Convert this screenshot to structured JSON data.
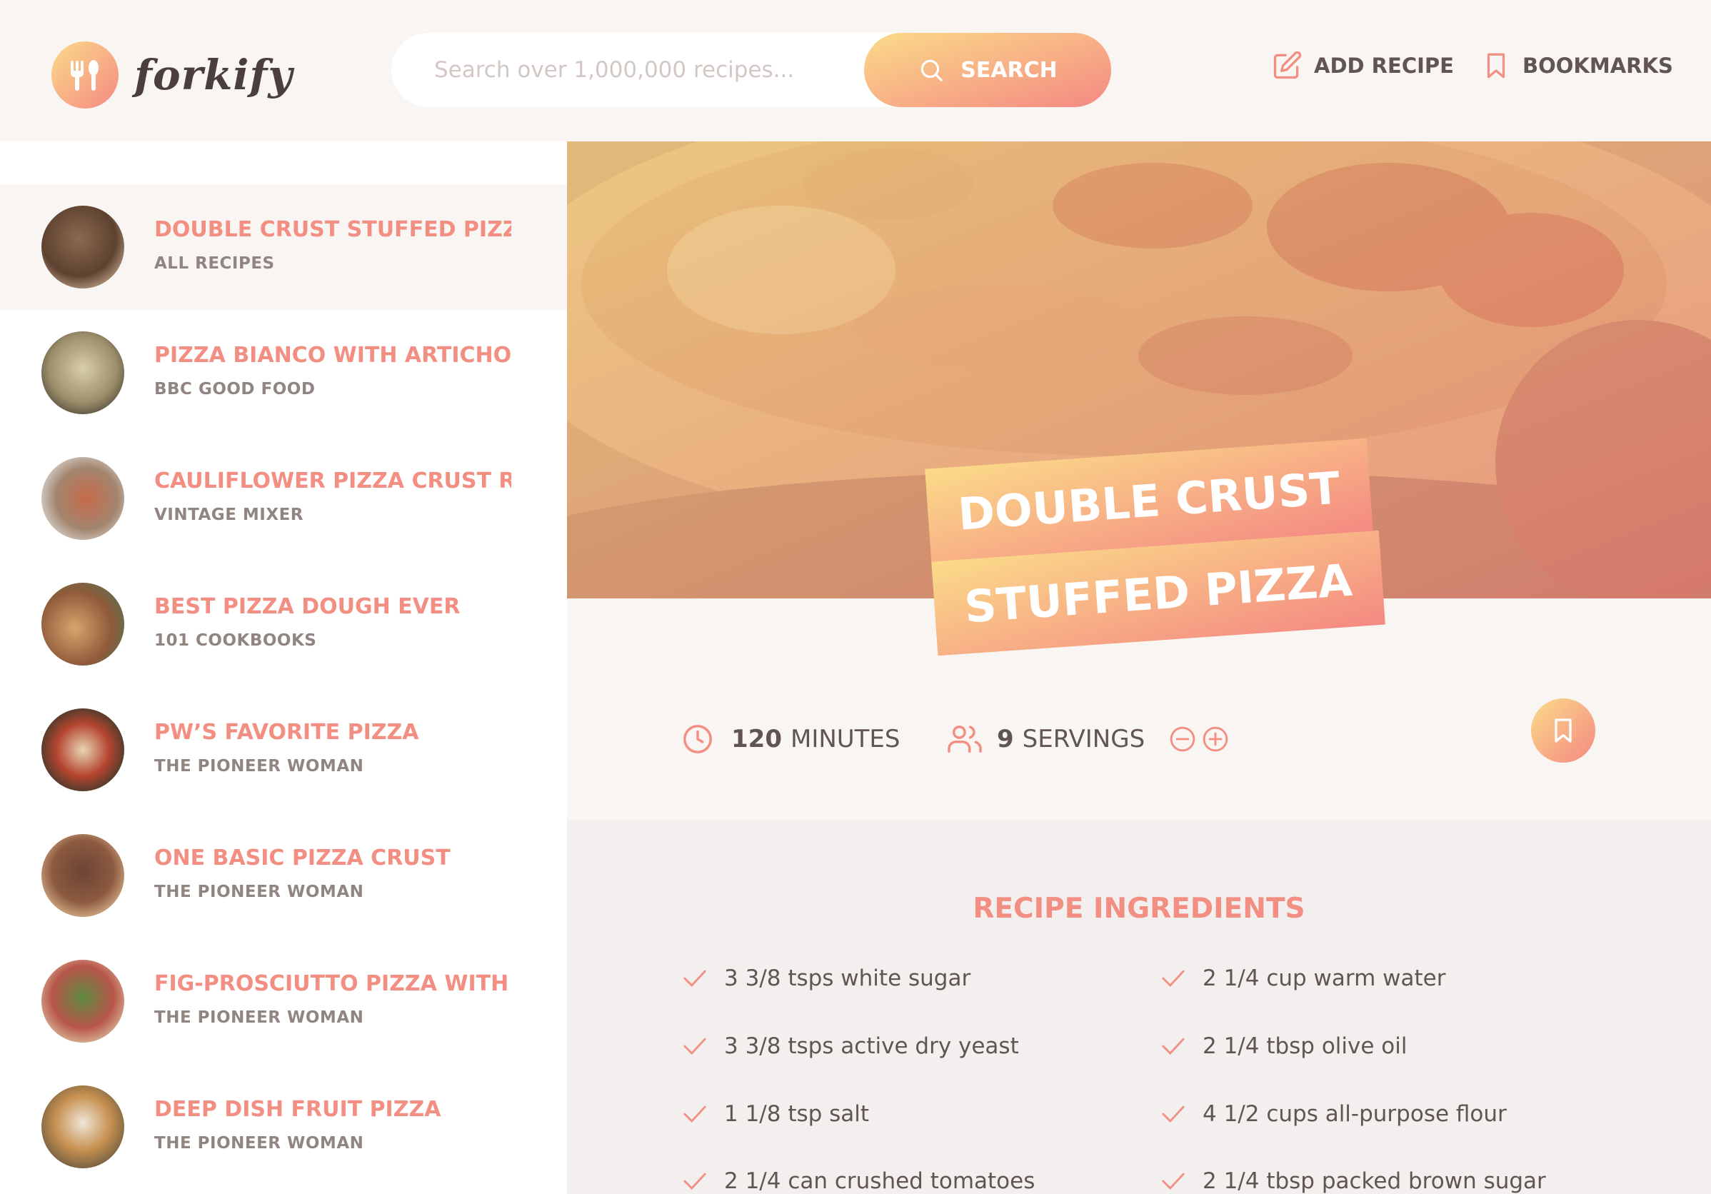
{
  "header": {
    "logo_text": "forkify",
    "search_placeholder": "Search over 1,000,000 recipes...",
    "search_button": "SEARCH",
    "add_recipe": "ADD RECIPE",
    "bookmarks": "BOOKMARKS"
  },
  "results": [
    {
      "title": "DOUBLE CRUST STUFFED PIZZA",
      "publisher": "ALL RECIPES",
      "active": true
    },
    {
      "title": "PIZZA BIANCO WITH ARTICHOKE ...",
      "publisher": "BBC GOOD FOOD",
      "active": false
    },
    {
      "title": "CAULIFLOWER PIZZA CRUST RECI...",
      "publisher": "VINTAGE MIXER",
      "active": false
    },
    {
      "title": "BEST PIZZA DOUGH EVER",
      "publisher": "101 COOKBOOKS",
      "active": false
    },
    {
      "title": "PW’S FAVORITE PIZZA",
      "publisher": "THE PIONEER WOMAN",
      "active": false
    },
    {
      "title": "ONE BASIC PIZZA CRUST",
      "publisher": "THE PIONEER WOMAN",
      "active": false
    },
    {
      "title": "FIG-PROSCIUTTO PIZZA WITH AR...",
      "publisher": "THE PIONEER WOMAN",
      "active": false
    },
    {
      "title": "DEEP DISH FRUIT PIZZA",
      "publisher": "THE PIONEER WOMAN",
      "active": false
    }
  ],
  "recipe": {
    "title_line1": "DOUBLE CRUST",
    "title_line2": "STUFFED PIZZA",
    "minutes_value": "120",
    "minutes_label": "MINUTES",
    "servings_value": "9",
    "servings_label": "SERVINGS",
    "ingredients_heading": "RECIPE INGREDIENTS",
    "ingredients": [
      "3 3/8 tsps white sugar",
      "2 1/4 cup warm water",
      "3 3/8 tsps active dry yeast",
      "2 1/4 tbsp olive oil",
      "1 1/8 tsp salt",
      "4 1/2 cups all-purpose flour",
      "2 1/4 can crushed tomatoes",
      "2 1/4 tbsp packed brown sugar"
    ]
  },
  "colors": {
    "accent": "#f38e82",
    "gradient_start": "#fbdb89",
    "gradient_end": "#f48982",
    "text": "#615551",
    "background": "#f9f5f3"
  },
  "icons": [
    "fork-knife-icon",
    "search-icon",
    "edit-icon",
    "bookmark-icon",
    "clock-icon",
    "users-icon",
    "minus-circle-icon",
    "plus-circle-icon",
    "check-icon"
  ]
}
